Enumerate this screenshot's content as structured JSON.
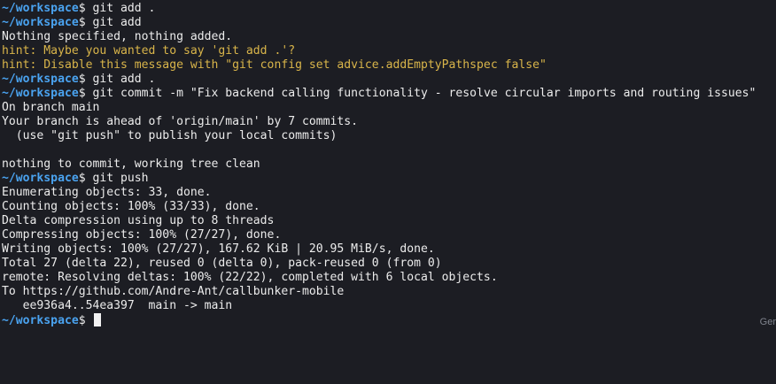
{
  "terminal": {
    "lines": [
      {
        "type": "prompt",
        "path": "~/workspace",
        "symbol": "$",
        "command": " git add ."
      },
      {
        "type": "prompt",
        "path": "~/workspace",
        "symbol": "$",
        "command": " git add"
      },
      {
        "type": "output",
        "text": "Nothing specified, nothing added."
      },
      {
        "type": "hint",
        "text": "hint: Maybe you wanted to say 'git add .'?"
      },
      {
        "type": "hint",
        "text": "hint: Disable this message with \"git config set advice.addEmptyPathspec false\""
      },
      {
        "type": "prompt",
        "path": "~/workspace",
        "symbol": "$",
        "command": " git add ."
      },
      {
        "type": "prompt",
        "path": "~/workspace",
        "symbol": "$",
        "command": " git commit -m \"Fix backend calling functionality - resolve circular imports and routing issues\""
      },
      {
        "type": "output",
        "text": "On branch main"
      },
      {
        "type": "output",
        "text": "Your branch is ahead of 'origin/main' by 7 commits."
      },
      {
        "type": "output",
        "text": "  (use \"git push\" to publish your local commits)"
      },
      {
        "type": "output",
        "text": ""
      },
      {
        "type": "output",
        "text": "nothing to commit, working tree clean"
      },
      {
        "type": "prompt",
        "path": "~/workspace",
        "symbol": "$",
        "command": " git push"
      },
      {
        "type": "output",
        "text": "Enumerating objects: 33, done."
      },
      {
        "type": "output",
        "text": "Counting objects: 100% (33/33), done."
      },
      {
        "type": "output",
        "text": "Delta compression using up to 8 threads"
      },
      {
        "type": "output",
        "text": "Compressing objects: 100% (27/27), done."
      },
      {
        "type": "output",
        "text": "Writing objects: 100% (27/27), 167.62 KiB | 20.95 MiB/s, done."
      },
      {
        "type": "output",
        "text": "Total 27 (delta 22), reused 0 (delta 0), pack-reused 0 (from 0)"
      },
      {
        "type": "output",
        "text": "remote: Resolving deltas: 100% (22/22), completed with 6 local objects."
      },
      {
        "type": "output",
        "text": "To https://github.com/Andre-Ant/callbunker-mobile"
      },
      {
        "type": "output",
        "text": "   ee936a4..54ea397  main -> main"
      },
      {
        "type": "prompt-active",
        "path": "~/workspace",
        "symbol": "$",
        "command": " "
      }
    ],
    "edge_label": "Ger"
  },
  "colors": {
    "background": "#1c1d23",
    "prompt_path": "#4aa3f0",
    "text": "#ececec",
    "hint": "#d9b54a",
    "cursor": "#f2f2f2"
  }
}
